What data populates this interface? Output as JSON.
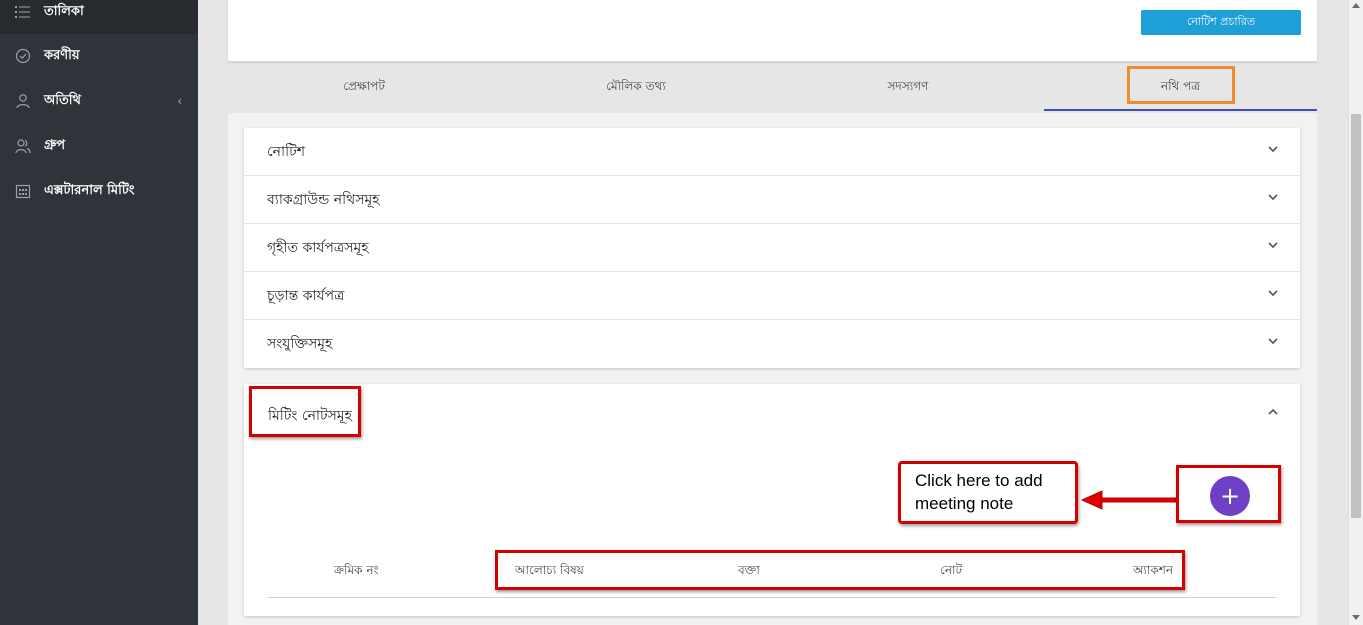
{
  "sidebar": {
    "items": [
      {
        "label": "তালিকা",
        "icon": "list-icon"
      },
      {
        "label": "করণীয়",
        "icon": "check-circle-icon"
      },
      {
        "label": "অতিথি",
        "icon": "user-icon",
        "expand": "‹"
      },
      {
        "label": "গ্রুপ",
        "icon": "group-icon"
      },
      {
        "label": "এক্সটারনাল মিটিং",
        "icon": "calendar-icon"
      }
    ]
  },
  "header": {
    "publish_label": "নোটিশ প্রচারিত"
  },
  "tabs": [
    {
      "label": "প্রেক্ষাপট"
    },
    {
      "label": "মৌলিক তথ্য"
    },
    {
      "label": "সদস্যগণ"
    },
    {
      "label": "নথি পত্র",
      "active": true
    }
  ],
  "sections": [
    {
      "label": "নোটিশ"
    },
    {
      "label": "ব্যাকগ্রাউন্ড নথিসমূহ"
    },
    {
      "label": "গৃহীত কার্যপত্রসমূহ"
    },
    {
      "label": "চূড়ান্ত কার্যপত্র"
    },
    {
      "label": "সংযুক্তিসমূহ"
    }
  ],
  "meeting_notes": {
    "title": "মিটিং নোটসমূহ",
    "add_label": "+",
    "callout": "Click here to add meeting note",
    "columns": [
      "ক্রমিক নং",
      "আলোচ্য বিষয়",
      "বক্তা",
      "নোট",
      "অ্যাকশন"
    ]
  },
  "colors": {
    "sidebar": "#2f343a",
    "primary_button": "#1e9fd6",
    "fab": "#6f3fc6",
    "highlight": "#d40000",
    "tab_highlight": "#f28b30",
    "active_tab_underline": "#3f51b5"
  }
}
